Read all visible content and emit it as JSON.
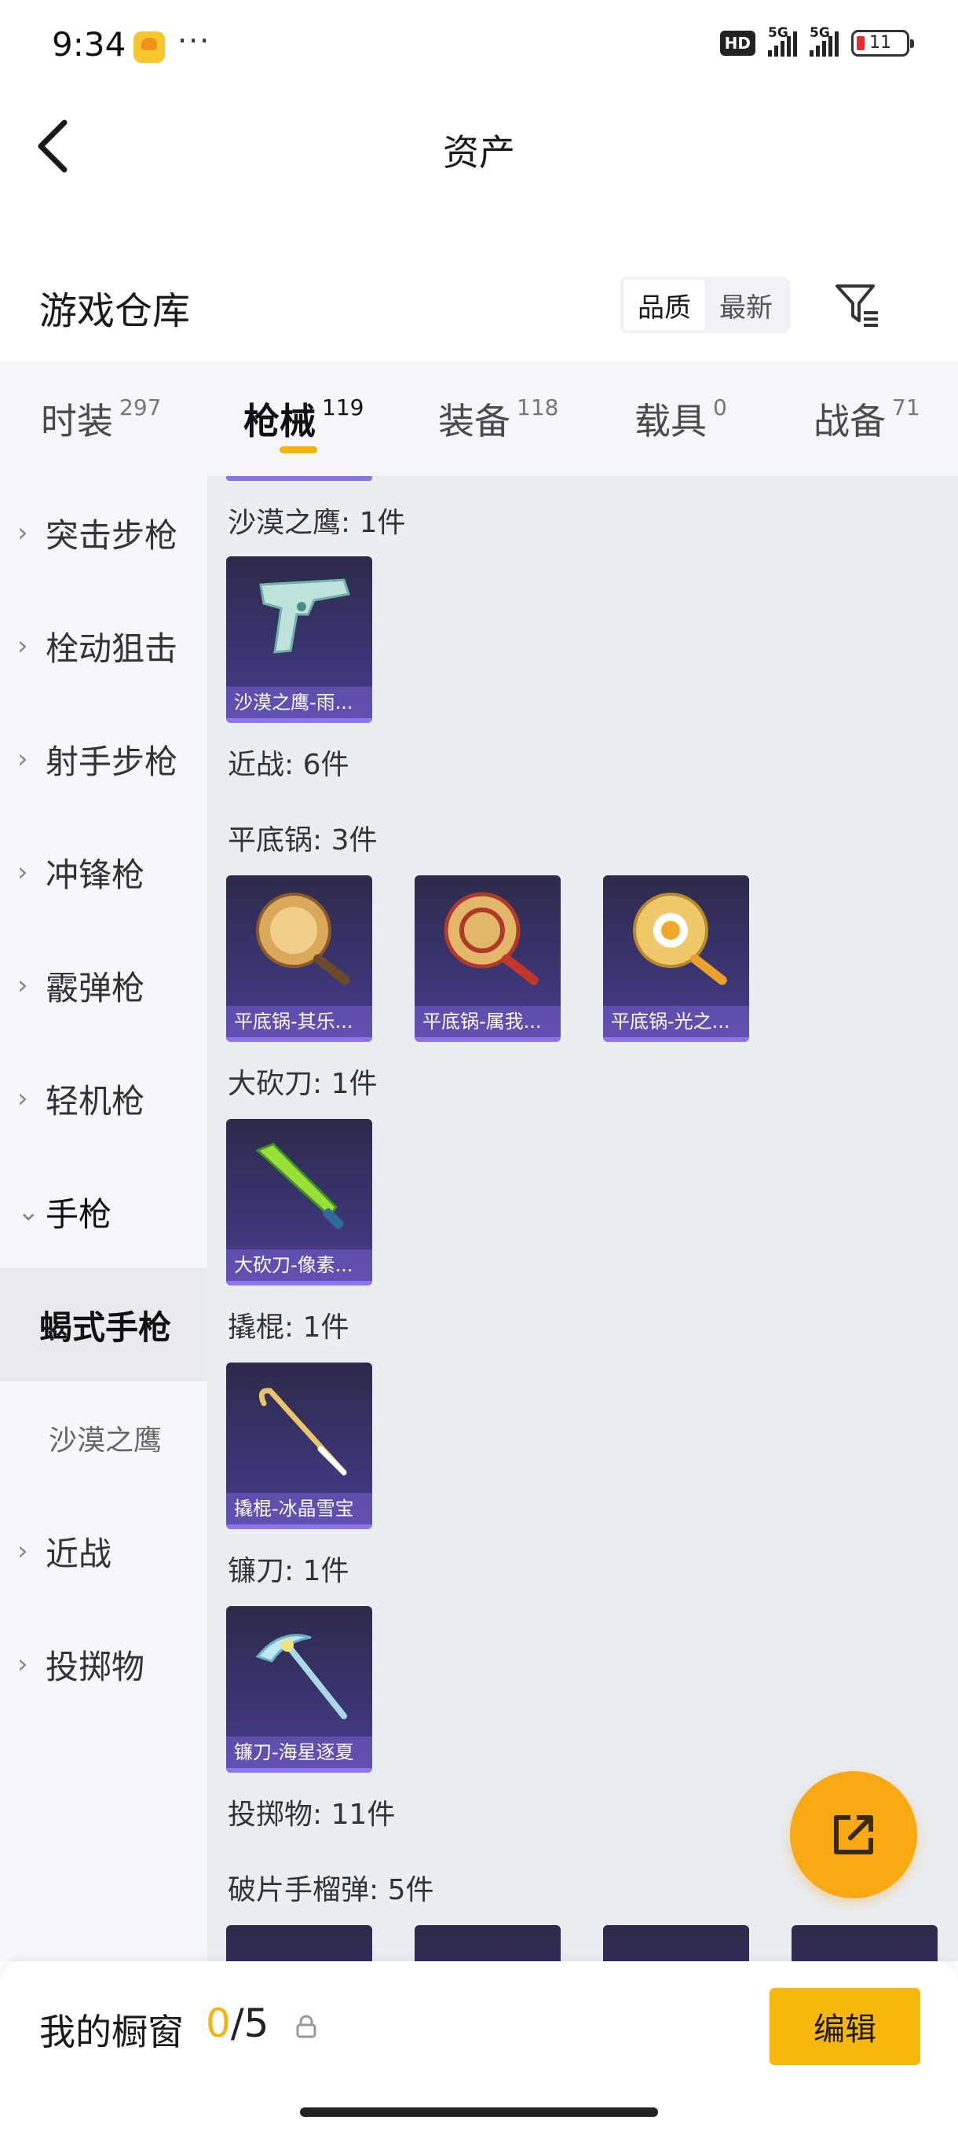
{
  "status_bar": {
    "time": "9:34",
    "dots": "···",
    "hd": "HD",
    "net1": "5G",
    "net2": "5G",
    "battery": "11"
  },
  "header": {
    "title": "资产",
    "back_icon": "chevron-left-icon"
  },
  "warehouse": {
    "title": "游戏仓库",
    "sort_options": [
      "品质",
      "最新"
    ],
    "sort_selected": "品质",
    "filter_icon": "filter-icon"
  },
  "tabs": [
    {
      "label": "时装",
      "count": "297",
      "active": false
    },
    {
      "label": "枪械",
      "count": "119",
      "active": true
    },
    {
      "label": "装备",
      "count": "118",
      "active": false
    },
    {
      "label": "载具",
      "count": "0",
      "active": false
    },
    {
      "label": "战备",
      "count": "71",
      "active": false
    }
  ],
  "sidebar": {
    "items": [
      {
        "label": "突击步枪",
        "chevron": "›"
      },
      {
        "label": "栓动狙击",
        "chevron": "›"
      },
      {
        "label": "射手步枪",
        "chevron": "›"
      },
      {
        "label": "冲锋枪",
        "chevron": "›"
      },
      {
        "label": "霰弹枪",
        "chevron": "›"
      },
      {
        "label": "轻机枪",
        "chevron": "›"
      },
      {
        "label": "手枪",
        "chevron": "⌄"
      },
      {
        "label": "蝎式手枪",
        "chevron": ""
      },
      {
        "label": "沙漠之鹰",
        "chevron": ""
      },
      {
        "label": "近战",
        "chevron": "›"
      },
      {
        "label": "投掷物",
        "chevron": "›"
      }
    ]
  },
  "content": {
    "sections": [
      {
        "label": "沙漠之鹰: 1件"
      },
      {
        "label": "近战: 6件"
      },
      {
        "label": "平底锅: 3件"
      },
      {
        "label": "大砍刀: 1件"
      },
      {
        "label": "撬棍: 1件"
      },
      {
        "label": "镰刀: 1件"
      },
      {
        "label": "投掷物: 11件"
      },
      {
        "label": "破片手榴弹: 5件"
      }
    ],
    "cards": [
      {
        "name": "沙漠之鹰-雨...",
        "icon": "desert-eagle-icon"
      },
      {
        "name": "平底锅-其乐...",
        "icon": "pan-icon"
      },
      {
        "name": "平底锅-属我...",
        "icon": "pan-icon"
      },
      {
        "name": "平底锅-光之...",
        "icon": "pan-icon"
      },
      {
        "name": "大砍刀-像素...",
        "icon": "machete-icon"
      },
      {
        "name": "撬棍-冰晶雪宝",
        "icon": "crowbar-icon"
      },
      {
        "name": "镰刀-海星逐夏",
        "icon": "sickle-icon"
      }
    ]
  },
  "fab": {
    "icon": "share-icon"
  },
  "bottom_bar": {
    "label": "我的橱窗",
    "current": "0",
    "separator": "/",
    "max": "5",
    "lock_icon": "lock-icon",
    "edit_label": "编辑"
  },
  "colors": {
    "accent": "#f5b40a",
    "card_bg": "#3a3470",
    "card_label": "#8d73ee"
  }
}
